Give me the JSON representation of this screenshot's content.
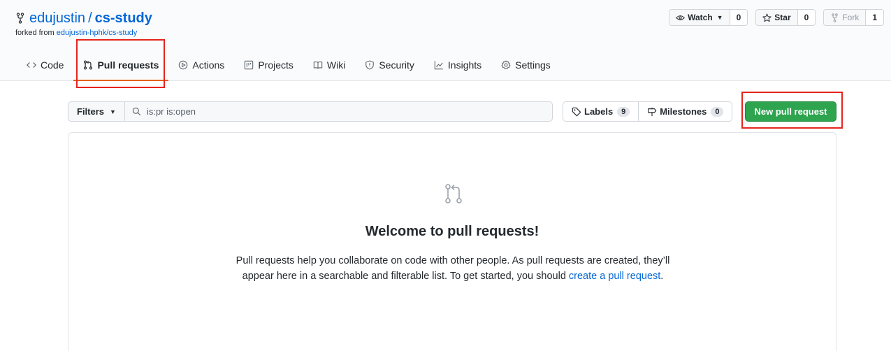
{
  "repo": {
    "owner": "edujustin",
    "separator": "/",
    "name": "cs-study",
    "forked_prefix": "forked from",
    "forked_source": "edujustin-hphk/cs-study"
  },
  "header_actions": {
    "watch": {
      "label": "Watch",
      "count": "0"
    },
    "star": {
      "label": "Star",
      "count": "0"
    },
    "fork": {
      "label": "Fork",
      "count": "1"
    }
  },
  "tabs": [
    {
      "label": "Code",
      "icon": "code-icon"
    },
    {
      "label": "Pull requests",
      "icon": "git-pull-request-icon",
      "selected": true
    },
    {
      "label": "Actions",
      "icon": "play-icon"
    },
    {
      "label": "Projects",
      "icon": "project-icon"
    },
    {
      "label": "Wiki",
      "icon": "book-icon"
    },
    {
      "label": "Security",
      "icon": "shield-icon"
    },
    {
      "label": "Insights",
      "icon": "graph-icon"
    },
    {
      "label": "Settings",
      "icon": "gear-icon"
    }
  ],
  "filters": {
    "label": "Filters",
    "search_value": "is:pr is:open"
  },
  "labels": {
    "label": "Labels",
    "count": "9"
  },
  "milestones": {
    "label": "Milestones",
    "count": "0"
  },
  "new_pr_label": "New pull request",
  "blankslate": {
    "title": "Welcome to pull requests!",
    "text": "Pull requests help you collaborate on code with other people. As pull requests are created, they’ll appear here in a searchable and filterable list. To get started, you should ",
    "link": "create a pull request",
    "suffix": "."
  },
  "colors": {
    "accent_link": "#0366d6",
    "primary_button": "#2ea44f",
    "highlight_box": "#e5251e",
    "selected_tab_underline": "#e36209"
  }
}
